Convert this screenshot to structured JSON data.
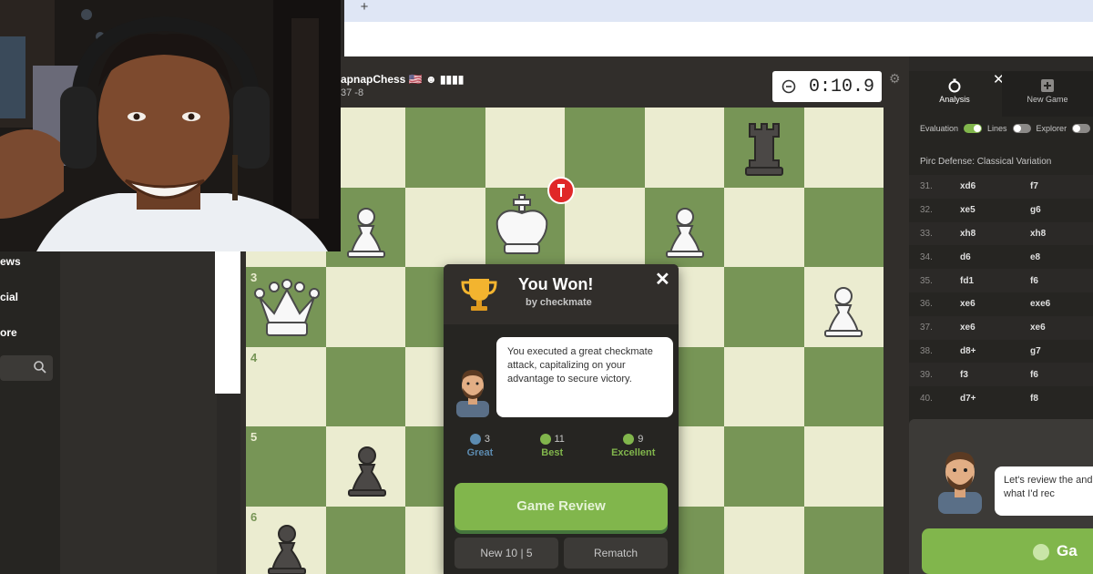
{
  "browser": {
    "new_tab": "+"
  },
  "left_nav": {
    "items": [
      "ews",
      "cial",
      "ore"
    ]
  },
  "player": {
    "name": "apnapChess 🇺🇸",
    "rating": "37  -8"
  },
  "clock": {
    "time": "0:10.9"
  },
  "board": {
    "rank_labels": [
      "3",
      "4",
      "5",
      "6"
    ]
  },
  "right_panel": {
    "tab_analysis": "Analysis",
    "tab_new_game": "New Game",
    "toggles": {
      "evaluation": "Evaluation",
      "lines": "Lines",
      "explorer": "Explorer"
    },
    "opening": "Pirc Defense: Classical Variation",
    "moves": [
      {
        "num": "31.",
        "white": "xd6",
        "black": "f7"
      },
      {
        "num": "32.",
        "white": "xe5",
        "black": "g6"
      },
      {
        "num": "33.",
        "white": "xh8",
        "black": "xh8"
      },
      {
        "num": "34.",
        "white": "d6",
        "black": "e8"
      },
      {
        "num": "35.",
        "white": "fd1",
        "black": "f6"
      },
      {
        "num": "36.",
        "white": "xe6",
        "black": "exe6"
      },
      {
        "num": "37.",
        "white": "xe6",
        "black": "xe6"
      },
      {
        "num": "38.",
        "white": "d8+",
        "black": "g7"
      },
      {
        "num": "39.",
        "white": "f3",
        "black": "f6"
      },
      {
        "num": "40.",
        "white": "d7+",
        "black": "f8"
      }
    ],
    "coach_text": "Let's review the and what I'd rec",
    "coach_button": "Ga"
  },
  "modal": {
    "title": "You Won!",
    "subtitle": "by checkmate",
    "message": "You executed a great checkmate attack, capitalizing on your advantage to secure victory.",
    "stats": [
      {
        "count": "3",
        "label": "Great",
        "color": "#5c8bb0"
      },
      {
        "count": "11",
        "label": "Best",
        "color": "#81b64c"
      },
      {
        "count": "9",
        "label": "Excellent",
        "color": "#81b64c"
      }
    ],
    "review_button": "Game Review",
    "new_button": "New 10 | 5",
    "rematch_button": "Rematch"
  },
  "colors": {
    "accent": "#81b64c",
    "board_light": "#ebecd0",
    "board_dark": "#779556"
  }
}
